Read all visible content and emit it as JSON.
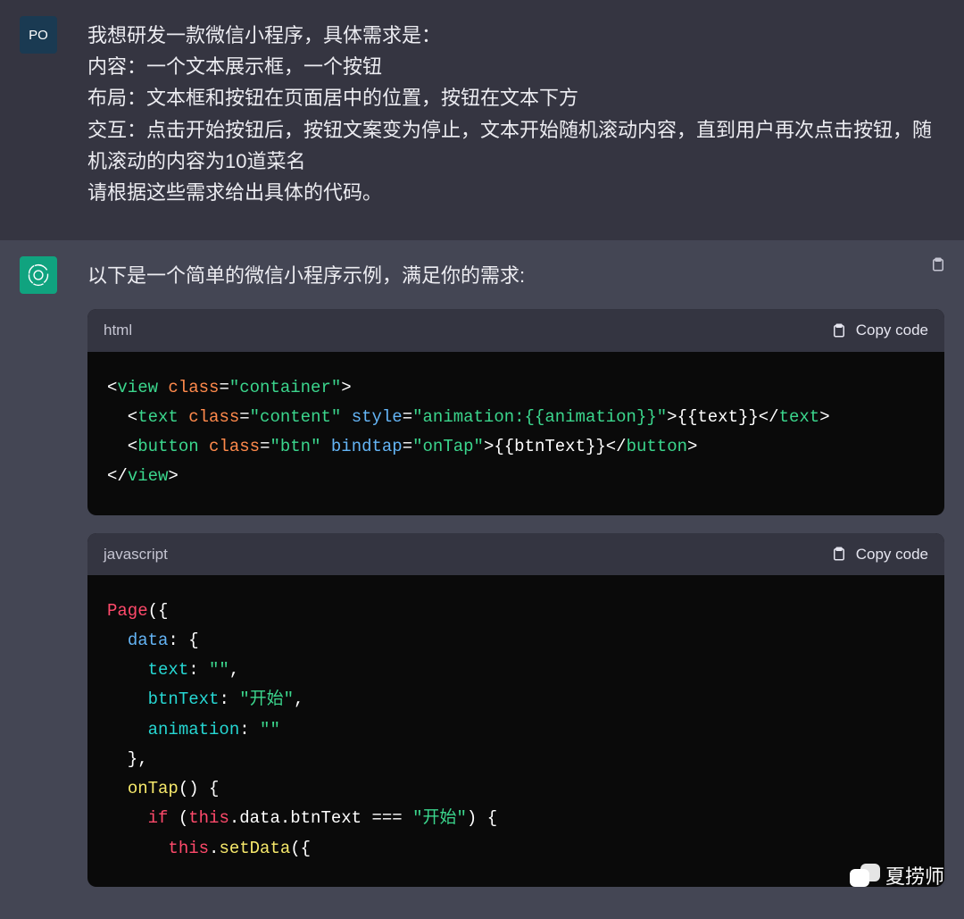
{
  "user": {
    "avatar": "PO",
    "lines": [
      "我想研发一款微信小程序，具体需求是：",
      "内容：一个文本展示框，一个按钮",
      "布局：文本框和按钮在页面居中的位置，按钮在文本下方",
      "交互：点击开始按钮后，按钮文案变为停止，文本开始随机滚动内容，直到用户再次点击按钮，随机滚动的内容为10道菜名",
      "请根据这些需求给出具体的代码。"
    ]
  },
  "assistant": {
    "intro": "以下是一个简单的微信小程序示例，满足你的需求:",
    "copy_label": "Copy code",
    "code1": {
      "lang": "html",
      "tokens": [
        [
          [
            "<",
            "pun"
          ],
          [
            "view",
            "tag"
          ],
          [
            " ",
            "pun"
          ],
          [
            "class",
            "attrOrange"
          ],
          [
            "=",
            "pun"
          ],
          [
            "\"container\"",
            "str"
          ],
          [
            ">",
            "pun"
          ]
        ],
        [
          [
            "  <",
            "pun"
          ],
          [
            "text",
            "tag"
          ],
          [
            " ",
            "pun"
          ],
          [
            "class",
            "attrOrange"
          ],
          [
            "=",
            "pun"
          ],
          [
            "\"content\"",
            "str"
          ],
          [
            " ",
            "pun"
          ],
          [
            "style",
            "attr"
          ],
          [
            "=",
            "pun"
          ],
          [
            "\"animation:{{animation}}\"",
            "str"
          ],
          [
            ">",
            "pun"
          ],
          [
            "{{text}}",
            "pun"
          ],
          [
            "</",
            "pun"
          ],
          [
            "text",
            "tag"
          ],
          [
            ">",
            "pun"
          ]
        ],
        [
          [
            "  <",
            "pun"
          ],
          [
            "button",
            "tag"
          ],
          [
            " ",
            "pun"
          ],
          [
            "class",
            "attrOrange"
          ],
          [
            "=",
            "pun"
          ],
          [
            "\"btn\"",
            "str"
          ],
          [
            " ",
            "pun"
          ],
          [
            "bindtap",
            "attr"
          ],
          [
            "=",
            "pun"
          ],
          [
            "\"onTap\"",
            "str"
          ],
          [
            ">",
            "pun"
          ],
          [
            "{{btnText}}",
            "pun"
          ],
          [
            "</",
            "pun"
          ],
          [
            "button",
            "tag"
          ],
          [
            ">",
            "pun"
          ]
        ],
        [
          [
            "</",
            "pun"
          ],
          [
            "view",
            "tag"
          ],
          [
            ">",
            "pun"
          ]
        ]
      ]
    },
    "code2": {
      "lang": "javascript",
      "tokens": [
        [
          [
            "Page",
            "red"
          ],
          [
            "({",
            "pun"
          ]
        ],
        [
          [
            "  ",
            "pun"
          ],
          [
            "data",
            "blue"
          ],
          [
            ": {",
            "pun"
          ]
        ],
        [
          [
            "    ",
            "pun"
          ],
          [
            "text",
            "turq"
          ],
          [
            ": ",
            "pun"
          ],
          [
            "\"\"",
            "strGreen"
          ],
          [
            ",",
            "pun"
          ]
        ],
        [
          [
            "    ",
            "pun"
          ],
          [
            "btnText",
            "turq"
          ],
          [
            ": ",
            "pun"
          ],
          [
            "\"开始\"",
            "strGreen"
          ],
          [
            ",",
            "pun"
          ]
        ],
        [
          [
            "    ",
            "pun"
          ],
          [
            "animation",
            "turq"
          ],
          [
            ": ",
            "pun"
          ],
          [
            "\"\"",
            "strGreen"
          ]
        ],
        [
          [
            "  },",
            "pun"
          ]
        ],
        [
          [
            "  ",
            "pun"
          ],
          [
            "onTap",
            "yel"
          ],
          [
            "() {",
            "pun"
          ]
        ],
        [
          [
            "    ",
            "pun"
          ],
          [
            "if",
            "red"
          ],
          [
            " (",
            "pun"
          ],
          [
            "this",
            "red"
          ],
          [
            ".data.btnText === ",
            "pun"
          ],
          [
            "\"开始\"",
            "strGreen"
          ],
          [
            ") {",
            "pun"
          ]
        ],
        [
          [
            "      ",
            "pun"
          ],
          [
            "this",
            "red"
          ],
          [
            ".",
            "pun"
          ],
          [
            "setData",
            "yel"
          ],
          [
            "({",
            "pun"
          ]
        ]
      ]
    }
  },
  "watermark": "夏捞师"
}
